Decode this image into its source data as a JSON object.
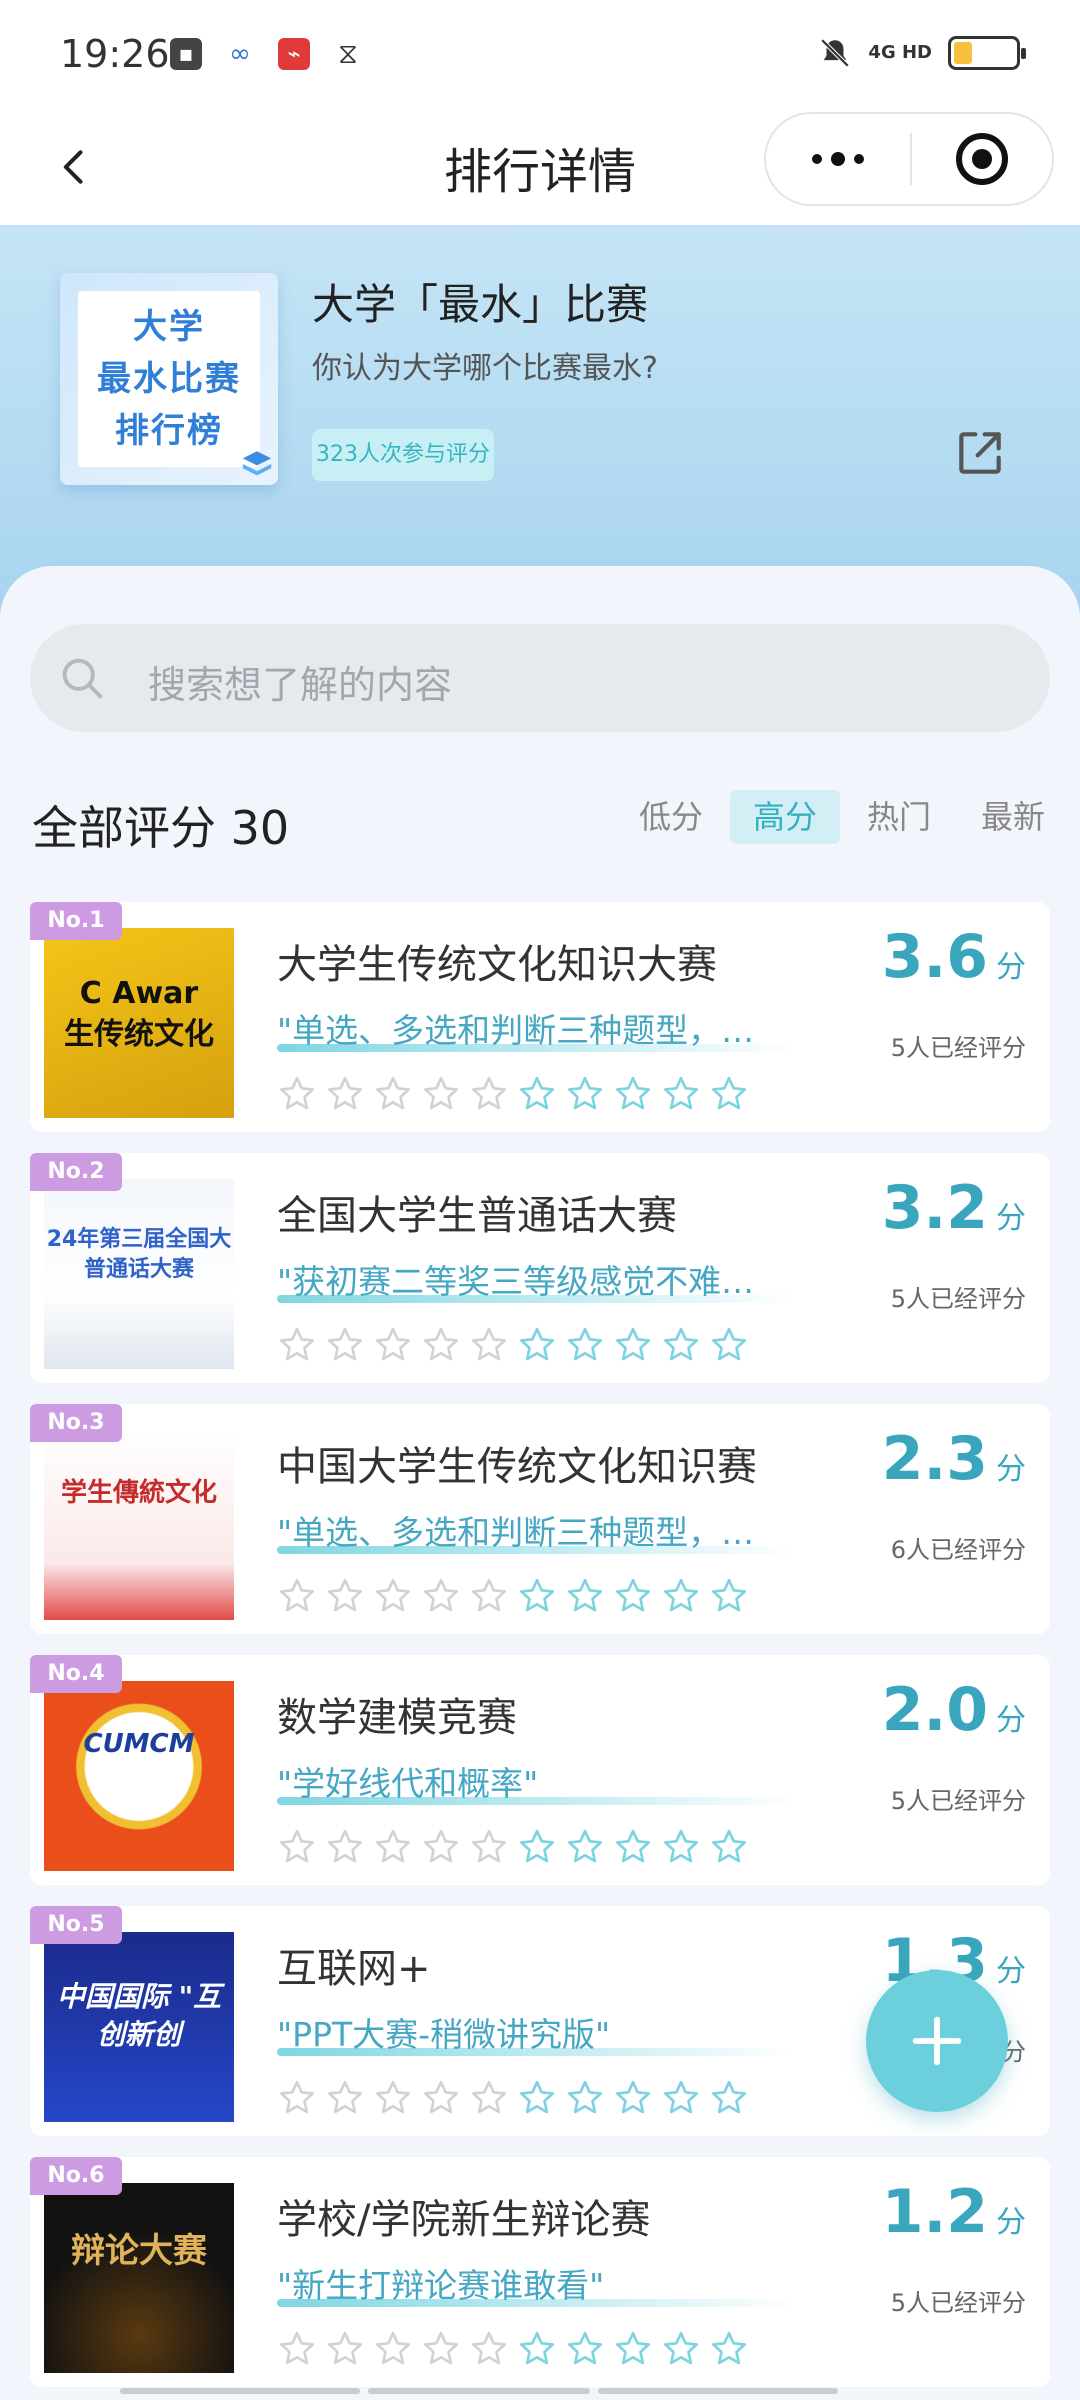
{
  "status": {
    "time": "19:26",
    "network": "4G HD",
    "battery": "4"
  },
  "nav": {
    "title": "排行详情"
  },
  "hero": {
    "cover_lines": [
      "大学",
      "最水比赛",
      "排行榜"
    ],
    "title": "大学「最水」比赛",
    "subtitle": "你认为大学哪个比赛最水?",
    "participants": "323人次参与评分"
  },
  "search": {
    "placeholder": "搜索想了解的内容"
  },
  "filter": {
    "label": "全部评分 30",
    "tabs": [
      "低分",
      "高分",
      "热门",
      "最新"
    ],
    "active": "高分"
  },
  "score_unit": "分",
  "items": [
    {
      "rank": "No.1",
      "name": "大学生传统文化知识大赛",
      "quote": "\"单选、多选和判断三种题型，…",
      "score": "3.6",
      "count": "5人已经评分",
      "thumb_text": "C Awar\n生传统文化"
    },
    {
      "rank": "No.2",
      "name": "全国大学生普通话大赛",
      "quote": "\"获初赛二等奖三等级感觉不难…",
      "score": "3.2",
      "count": "5人已经评分",
      "thumb_text": "24年第三届全国大\n普通话大赛"
    },
    {
      "rank": "No.3",
      "name": "中国大学生传统文化知识赛",
      "quote": "\"单选、多选和判断三种题型，…",
      "score": "2.3",
      "count": "6人已经评分",
      "thumb_text": "学生傳統文化"
    },
    {
      "rank": "No.4",
      "name": "数学建模竞赛",
      "quote": "\"学好线代和概率\"",
      "score": "2.0",
      "count": "5人已经评分",
      "thumb_text": "CUMCM"
    },
    {
      "rank": "No.5",
      "name": "互联网+",
      "quote": "\"PPT大赛-稍微讲究版\"",
      "score": "1.3",
      "count": "5人已经评分",
      "thumb_text": "中国国际 \"互\n创新创"
    },
    {
      "rank": "No.6",
      "name": "学校/学院新生辩论赛",
      "quote": "\"新生打辩论赛谁敢看\"",
      "score": "1.2",
      "count": "5人已经评分",
      "thumb_text": "辩论大赛"
    }
  ],
  "icons": {
    "back": "chevron-left-icon",
    "more": "more-dots-icon",
    "target": "target-icon",
    "share": "share-icon",
    "search": "search-icon",
    "star": "star-outline-icon",
    "add": "plus-icon"
  },
  "colors": {
    "accent": "#3aa6bd",
    "rank_badge": "#cc9be2",
    "fab": "#6cd0dc"
  }
}
